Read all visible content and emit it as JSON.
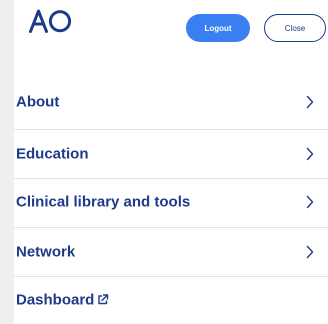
{
  "header": {
    "logo_text": "AO",
    "logout_label": "Logout",
    "close_label": "Close"
  },
  "menu": {
    "items": [
      {
        "label": "About",
        "icon": "chevron-right-icon"
      },
      {
        "label": "Education",
        "icon": "chevron-right-icon"
      },
      {
        "label": "Clinical library and tools",
        "icon": "chevron-right-icon"
      },
      {
        "label": "Network",
        "icon": "chevron-right-icon"
      },
      {
        "label": "Dashboard",
        "icon": "external-link-icon"
      }
    ]
  },
  "colors": {
    "brand_navy": "#1e3a8a",
    "primary_button": "#3a7ff2",
    "side_strip": "#f1efed"
  }
}
